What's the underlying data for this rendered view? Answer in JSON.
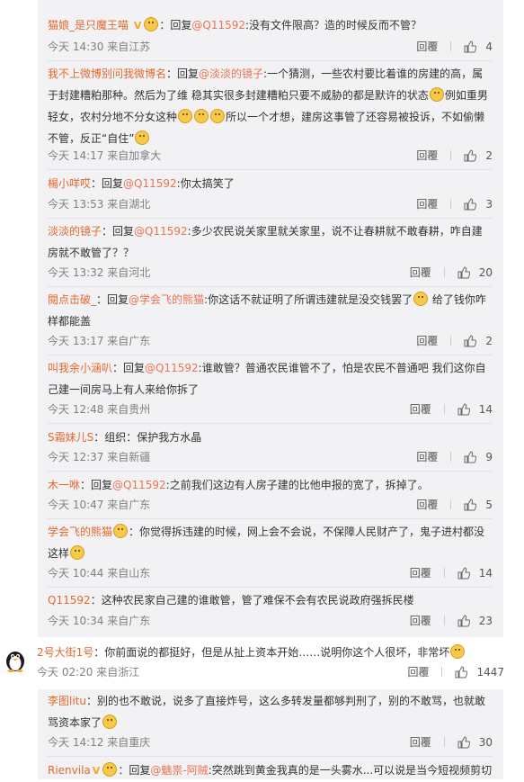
{
  "comments": [
    {
      "user": "猫娘_是只魔王喵",
      "reply_to": "@Q11592",
      "prefix": "：回复",
      "text": ":没有文件限高？造的时候反而不管？",
      "time": "今天 14:30 来自江苏",
      "reply_label": "回覆",
      "likes": "4"
    },
    {
      "user": "我不上微博别问我微博名",
      "reply_to": "@淡淡的镜子",
      "prefix": "：回复",
      "text": ":一个猜测，一些农村要比着谁的房建的高，属于封建糟粕那种。然后为了维 稳其实很多封建糟粕只要不威胁的都是默许的状态",
      "text2": "例如重男轻女，农村分地不分女这种",
      "text3": "所以一个才想，建房这事管了还容易被投诉，不如偷懒不管，反正“自住”",
      "time": "今天 14:17 来自加拿大",
      "reply_label": "回覆",
      "likes": "2"
    },
    {
      "user": "楊小咩哎",
      "reply_to": "@Q11592",
      "prefix": "：回复",
      "text": ":你太搞笑了",
      "time": "今天 13:53 来自湖北",
      "reply_label": "回覆",
      "likes": "3"
    },
    {
      "user": "淡淡的镜子",
      "reply_to": "@Q11592",
      "prefix": "：回复",
      "text": ":多少农民说关家里就关家里，说不让春耕就不敢春耕，咋自建房就不敢管了？？",
      "time": "今天 13:32 来自河北",
      "reply_label": "回覆",
      "likes": "20"
    },
    {
      "user": "閱点击破_",
      "reply_to": "@学会飞的熊猫",
      "prefix": "：回复",
      "text": ":你这话不就证明了所谓违建就是没交钱罢了",
      "text2": " 给了钱你咋样都能盖",
      "time": "今天 13:17 来自广东",
      "reply_label": "回覆",
      "likes": "2"
    },
    {
      "user": "叫我余小涵叭",
      "reply_to": "@Q11592",
      "prefix": "：回复",
      "text": ":谁敢管？普通农民谁管不了，怕是农民不普通吧 我们这你自己建一间房马上有人来给你拆了",
      "time": "今天 12:48 来自贵州",
      "reply_label": "回覆",
      "likes": "14"
    },
    {
      "user": "S霜妹儿S",
      "text": "：组织：保护我方水晶",
      "time": "今天 12:37 来自新疆",
      "reply_label": "回覆",
      "likes": "9"
    },
    {
      "user": "木一咻",
      "reply_to": "@Q11592",
      "prefix": "：回复",
      "text": ":之前我们这边有人房子建的比他申报的宽了，拆掉了。",
      "time": "今天 10:47 来自广东",
      "reply_label": "回覆",
      "likes": "5"
    },
    {
      "user": "学会飞的熊猫",
      "text": "：你觉得拆违建的时候，网上会不会说，不保障人民财产了，鬼子进村都没这样",
      "time": "今天 10:44 来自山东",
      "reply_label": "回覆",
      "likes": "14"
    },
    {
      "user": "Q11592",
      "text": "：这种农民家自己建的谁敢管，管了难保不会有农民说政府强拆民楼",
      "time": "今天 10:34 来自广东",
      "reply_label": "回覆",
      "likes": "23"
    }
  ],
  "top_comment": {
    "user": "2号大街1号",
    "text": "：你前面说的都挺好，但是从扯上资本开始……说明你这个人很坏，非常坏",
    "time": "今天 02:20 来自浙江",
    "reply_label": "回覆",
    "likes": "1447"
  },
  "sub_comments": [
    {
      "user": "李图litu",
      "text": "：别的也不敢说，说多了直接炸号，这么多转发量都够判刑了，别的不敢骂，也就敢骂资本家了",
      "time": "今天 14:12 来自重庆",
      "reply_label": "回覆",
      "likes": "30"
    },
    {
      "user": "Rienvila",
      "reply_to": "@魑祟-阿贼",
      "prefix": "：回复",
      "text": ":突然跳到黄金我真的是一头雾水...可以说是当今短视频剪切"
    }
  ],
  "icons": {
    "emoji": "smiley-emoji-icon",
    "like": "thumb-up-icon",
    "avatar": "penguin-avatar-icon",
    "vip": "vip-badge-icon"
  },
  "colors": {
    "username": "#e06a2c",
    "mention": "#eb7350",
    "meta": "#808080",
    "panel": "#f2f2f5"
  }
}
